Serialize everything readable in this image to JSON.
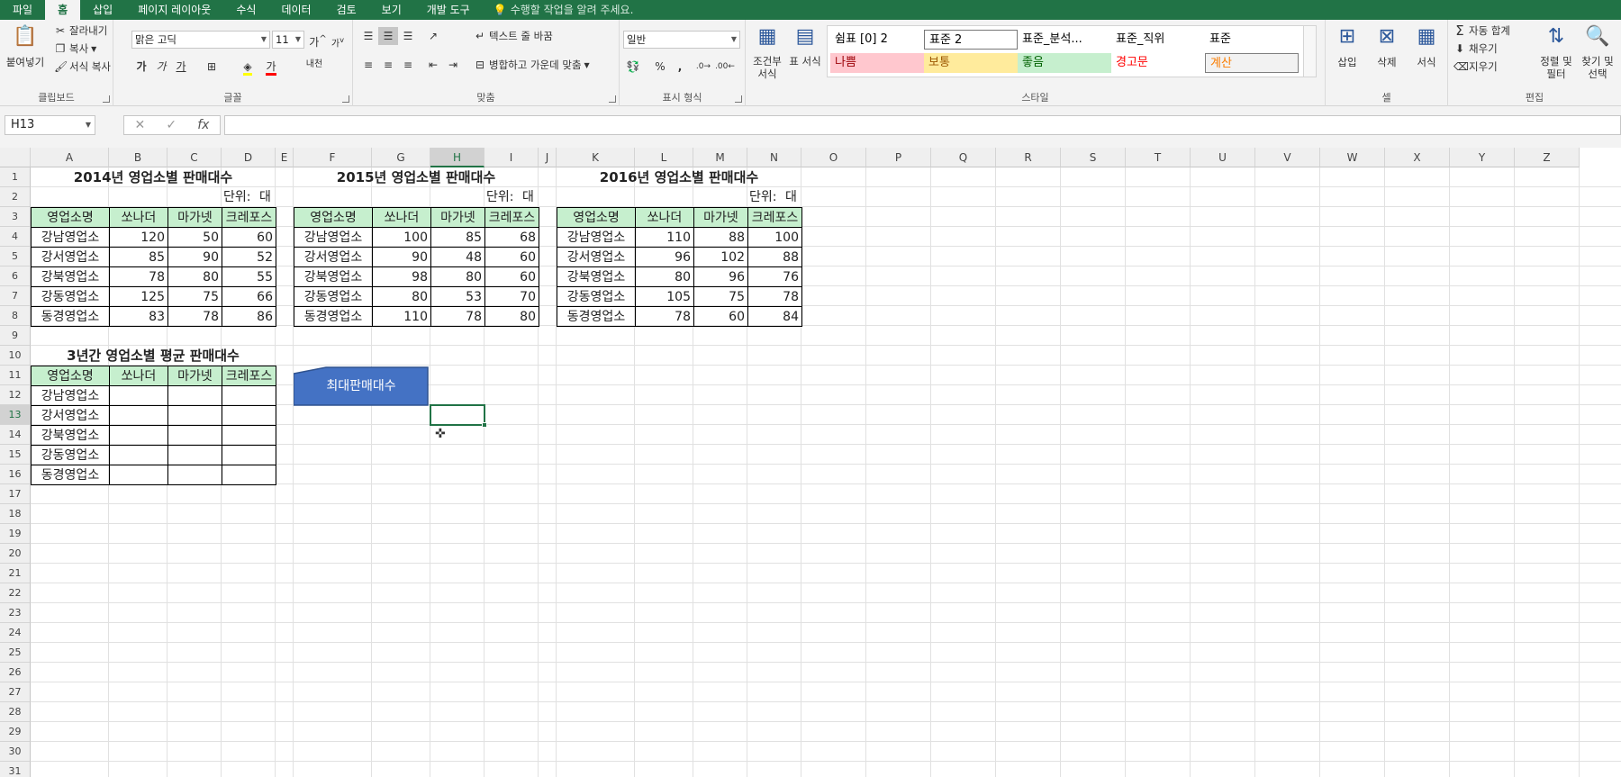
{
  "tabs": [
    "파일",
    "홈",
    "삽입",
    "페이지 레이아웃",
    "수식",
    "데이터",
    "검토",
    "보기",
    "개발 도구"
  ],
  "active_tab": 1,
  "tell_me": "수행할 작업을 알려 주세요.",
  "ribbon": {
    "clipboard": {
      "paste": "붙여넣기",
      "cut": "잘라내기",
      "copy": "복사",
      "format_painter": "서식 복사",
      "label": "클립보드"
    },
    "font": {
      "name": "맑은 고딕",
      "size": "11",
      "label": "글꼴",
      "bold": "가",
      "italic": "가",
      "underline": "가",
      "grow": "가",
      "shrink": "가",
      "font_color": "가",
      "phonetic": "내천"
    },
    "alignment": {
      "wrap": "텍스트 줄 바꿈",
      "merge": "병합하고 가운데 맞춤",
      "label": "맞춤"
    },
    "number": {
      "format": "일반",
      "label": "표시 형식",
      "percent": "%",
      "comma": ","
    },
    "styles": {
      "conditional": "조건부 서식",
      "table": "표 서식",
      "label": "스타일",
      "gallery": [
        {
          "name": "쉼표 [0] 2",
          "bg": "#ffffff",
          "fg": "#000000"
        },
        {
          "name": "표준 2",
          "bg": "#ffffff",
          "fg": "#000000"
        },
        {
          "name": "표준_분석...",
          "bg": "#ffffff",
          "fg": "#000000"
        },
        {
          "name": "표준_직위",
          "bg": "#ffffff",
          "fg": "#000000"
        },
        {
          "name": "표준",
          "bg": "#ffffff",
          "fg": "#000000"
        },
        {
          "name": "나쁨",
          "bg": "#ffc7ce",
          "fg": "#9c0006"
        },
        {
          "name": "보통",
          "bg": "#ffeb9c",
          "fg": "#9c5700"
        },
        {
          "name": "좋음",
          "bg": "#c6efce",
          "fg": "#006100"
        },
        {
          "name": "경고문",
          "bg": "#ffffff",
          "fg": "#ff0000"
        },
        {
          "name": "계산",
          "bg": "#f2f2f2",
          "fg": "#fa7d00"
        }
      ]
    },
    "cells": {
      "insert": "삽입",
      "delete": "삭제",
      "format": "서식",
      "label": "셀"
    },
    "editing": {
      "autosum": "자동 합계",
      "fill": "채우기",
      "clear": "지우기",
      "sort": "정렬 및 필터",
      "find": "찾기 및 선택",
      "label": "편집"
    }
  },
  "formula_bar": {
    "name_box": "H13",
    "formula": ""
  },
  "columns": [
    "A",
    "B",
    "C",
    "D",
    "E",
    "F",
    "G",
    "H",
    "I",
    "J",
    "K",
    "L",
    "M",
    "N",
    "O",
    "P",
    "Q",
    "R",
    "S",
    "T",
    "U",
    "V",
    "W",
    "X",
    "Y",
    "Z"
  ],
  "rows": [
    "1",
    "2",
    "3",
    "4",
    "5",
    "6",
    "7",
    "8",
    "9",
    "10",
    "11",
    "12",
    "13",
    "14",
    "15",
    "16",
    "17",
    "18",
    "19",
    "20",
    "21",
    "22",
    "23",
    "24",
    "25",
    "26",
    "27",
    "28",
    "29",
    "30",
    "31"
  ],
  "selected_col": "H",
  "selected_row": "13",
  "tables": [
    {
      "title": "2014년 영업소별 판매대수",
      "unit_label": "단위:",
      "unit": "대",
      "headers": [
        "영업소명",
        "쏘나더",
        "마가넷",
        "크레포스"
      ],
      "rows": [
        [
          "강남영업소",
          "120",
          "50",
          "60"
        ],
        [
          "강서영업소",
          "85",
          "90",
          "52"
        ],
        [
          "강북영업소",
          "78",
          "80",
          "55"
        ],
        [
          "강동영업소",
          "125",
          "75",
          "66"
        ],
        [
          "동경영업소",
          "83",
          "78",
          "86"
        ]
      ]
    },
    {
      "title": "2015년 영업소별 판매대수",
      "unit_label": "단위:",
      "unit": "대",
      "headers": [
        "영업소명",
        "쏘나더",
        "마가넷",
        "크레포스"
      ],
      "rows": [
        [
          "강남영업소",
          "100",
          "85",
          "68"
        ],
        [
          "강서영업소",
          "90",
          "48",
          "60"
        ],
        [
          "강북영업소",
          "98",
          "80",
          "60"
        ],
        [
          "강동영업소",
          "80",
          "53",
          "70"
        ],
        [
          "동경영업소",
          "110",
          "78",
          "80"
        ]
      ]
    },
    {
      "title": "2016년 영업소별 판매대수",
      "unit_label": "단위:",
      "unit": "대",
      "headers": [
        "영업소명",
        "쏘나더",
        "마가넷",
        "크레포스"
      ],
      "rows": [
        [
          "강남영업소",
          "110",
          "88",
          "100"
        ],
        [
          "강서영업소",
          "96",
          "102",
          "88"
        ],
        [
          "강북영업소",
          "80",
          "96",
          "76"
        ],
        [
          "강동영업소",
          "105",
          "75",
          "78"
        ],
        [
          "동경영업소",
          "78",
          "60",
          "84"
        ]
      ]
    }
  ],
  "avg_table": {
    "title": "3년간 영업소별 평균 판매대수",
    "headers": [
      "영업소명",
      "쏘나더",
      "마가넷",
      "크레포스"
    ],
    "rows": [
      "강남영업소",
      "강서영업소",
      "강북영업소",
      "강동영업소",
      "동경영업소"
    ]
  },
  "shape": {
    "label": "최대판매대수",
    "fill": "#4472c4",
    "stroke": "#2f528f"
  },
  "colors": {
    "accent": "#217346",
    "header_fill": "#c6efce"
  }
}
